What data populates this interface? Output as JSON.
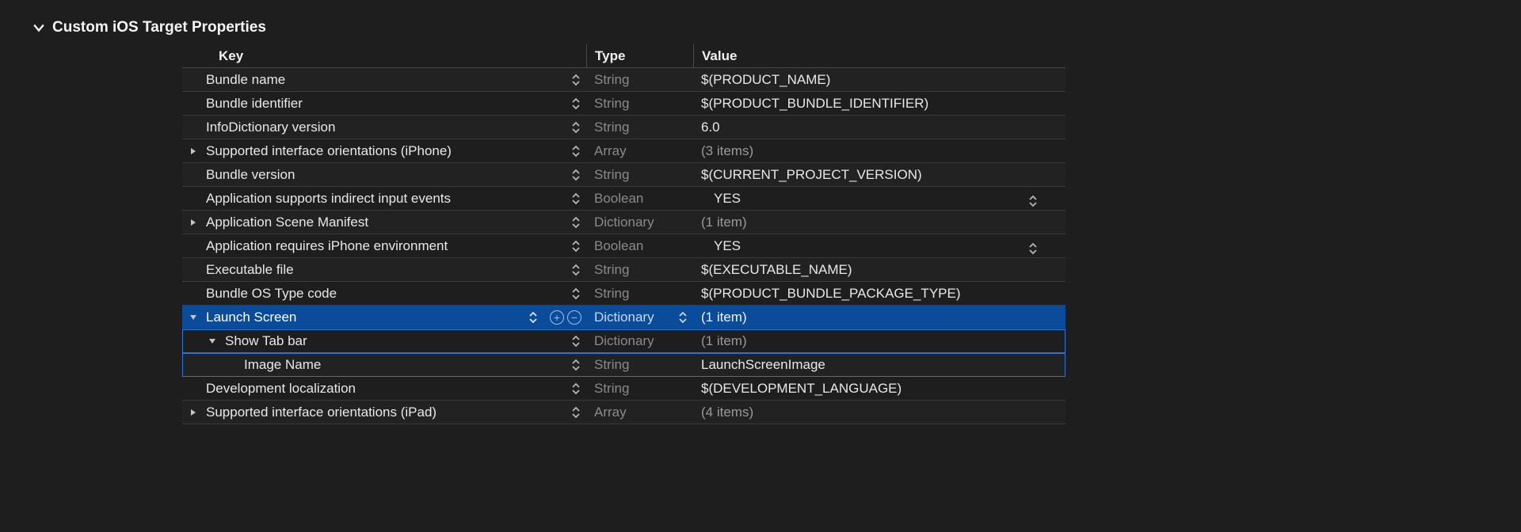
{
  "section": {
    "title": "Custom iOS Target Properties"
  },
  "header": {
    "key": "Key",
    "type": "Type",
    "value": "Value"
  },
  "rows": [
    {
      "indent": 0,
      "disclosure": "",
      "key": "Bundle name",
      "type": "String",
      "value": "$(PRODUCT_NAME)",
      "dim": false
    },
    {
      "indent": 0,
      "disclosure": "",
      "key": "Bundle identifier",
      "type": "String",
      "value": "$(PRODUCT_BUNDLE_IDENTIFIER)",
      "dim": false
    },
    {
      "indent": 0,
      "disclosure": "",
      "key": "InfoDictionary version",
      "type": "String",
      "value": "6.0",
      "dim": false
    },
    {
      "indent": 0,
      "disclosure": "right",
      "key": "Supported interface orientations (iPhone)",
      "type": "Array",
      "value": "(3 items)",
      "dim": true
    },
    {
      "indent": 0,
      "disclosure": "",
      "key": "Bundle version",
      "type": "String",
      "value": "$(CURRENT_PROJECT_VERSION)",
      "dim": false
    },
    {
      "indent": 0,
      "disclosure": "",
      "key": "Application supports indirect input events",
      "type": "Boolean",
      "value": "YES",
      "dim": false,
      "boolStepper": true,
      "boolIndent": true
    },
    {
      "indent": 0,
      "disclosure": "right",
      "key": "Application Scene Manifest",
      "type": "Dictionary",
      "value": "(1 item)",
      "dim": true
    },
    {
      "indent": 0,
      "disclosure": "",
      "key": "Application requires iPhone environment",
      "type": "Boolean",
      "value": "YES",
      "dim": false,
      "boolStepper": true,
      "boolIndent": true
    },
    {
      "indent": 0,
      "disclosure": "",
      "key": "Executable file",
      "type": "String",
      "value": "$(EXECUTABLE_NAME)",
      "dim": false
    },
    {
      "indent": 0,
      "disclosure": "",
      "key": "Bundle OS Type code",
      "type": "String",
      "value": "$(PRODUCT_BUNDLE_PACKAGE_TYPE)",
      "dim": false
    },
    {
      "indent": 0,
      "disclosure": "down",
      "key": "Launch Screen",
      "type": "Dictionary",
      "value": "(1 item)",
      "dim": true,
      "selected": true,
      "typeStepper": true,
      "addremove": true
    },
    {
      "indent": 1,
      "disclosure": "down",
      "key": "Show Tab bar",
      "type": "Dictionary",
      "value": "(1 item)",
      "dim": true,
      "childsel": true
    },
    {
      "indent": 2,
      "disclosure": "",
      "key": "Image Name",
      "type": "String",
      "value": "LaunchScreenImage",
      "dim": false,
      "childsel": true
    },
    {
      "indent": 0,
      "disclosure": "",
      "key": "Development localization",
      "type": "String",
      "value": "$(DEVELOPMENT_LANGUAGE)",
      "dim": false
    },
    {
      "indent": 0,
      "disclosure": "right",
      "key": "Supported interface orientations (iPad)",
      "type": "Array",
      "value": "(4 items)",
      "dim": true
    }
  ]
}
